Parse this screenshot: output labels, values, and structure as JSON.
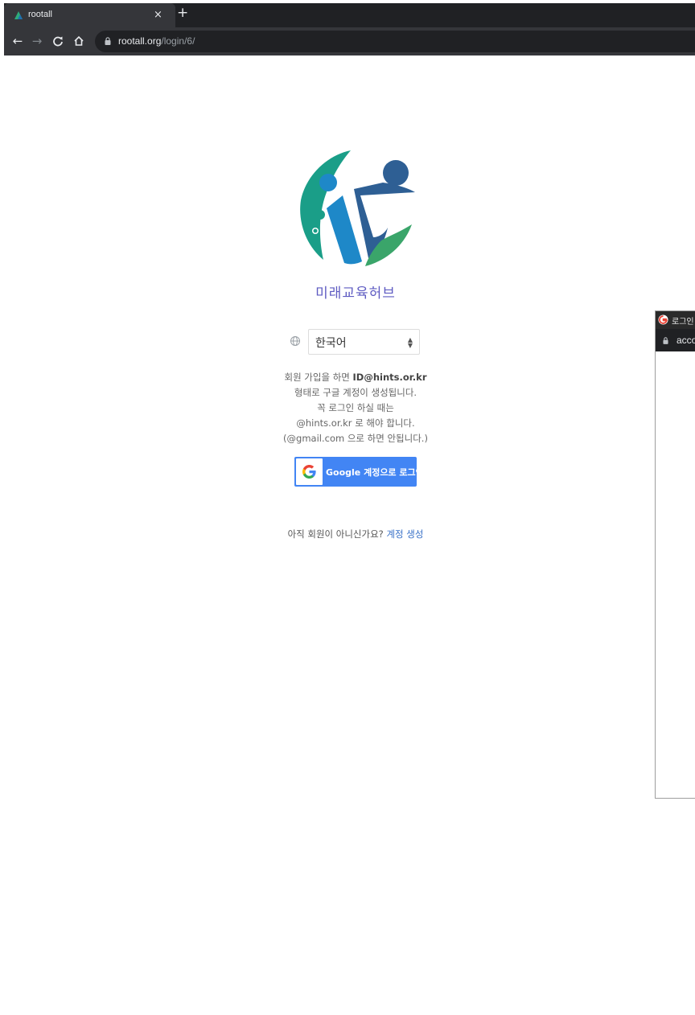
{
  "browser": {
    "tab_title": "rootall",
    "tab_close": "×",
    "new_tab": "+",
    "url_host": "rootall.org",
    "url_path": "/login/6/"
  },
  "site": {
    "title": "미래교육허브"
  },
  "language": {
    "selected": "한국어"
  },
  "notice": {
    "line1_prefix": "회원 가입을 하면 ",
    "line1_bold": "ID@hints.or.kr",
    "line2": "형태로 구글 계정이 생성됩니다.",
    "line3": "꼭 로그인 하실 때는",
    "line4": "@hints.or.kr 로 해야 합니다.",
    "line5": "(@gmail.com 으로 하면 안됩니다.)"
  },
  "google_login": {
    "label": "Google 계정으로 로그인"
  },
  "signup": {
    "prompt": "아직 회원이 아니신가요?",
    "link": "계정 생성"
  },
  "popup": {
    "title": "로그인",
    "url": "acco"
  },
  "colors": {
    "accent": "#5e5bc2",
    "google_blue": "#4285f4",
    "link": "#3a72c8",
    "logo_teal": "#1a9e88",
    "logo_blue": "#1e88c8",
    "logo_navy": "#2e5f94",
    "logo_green": "#3aa56a"
  }
}
